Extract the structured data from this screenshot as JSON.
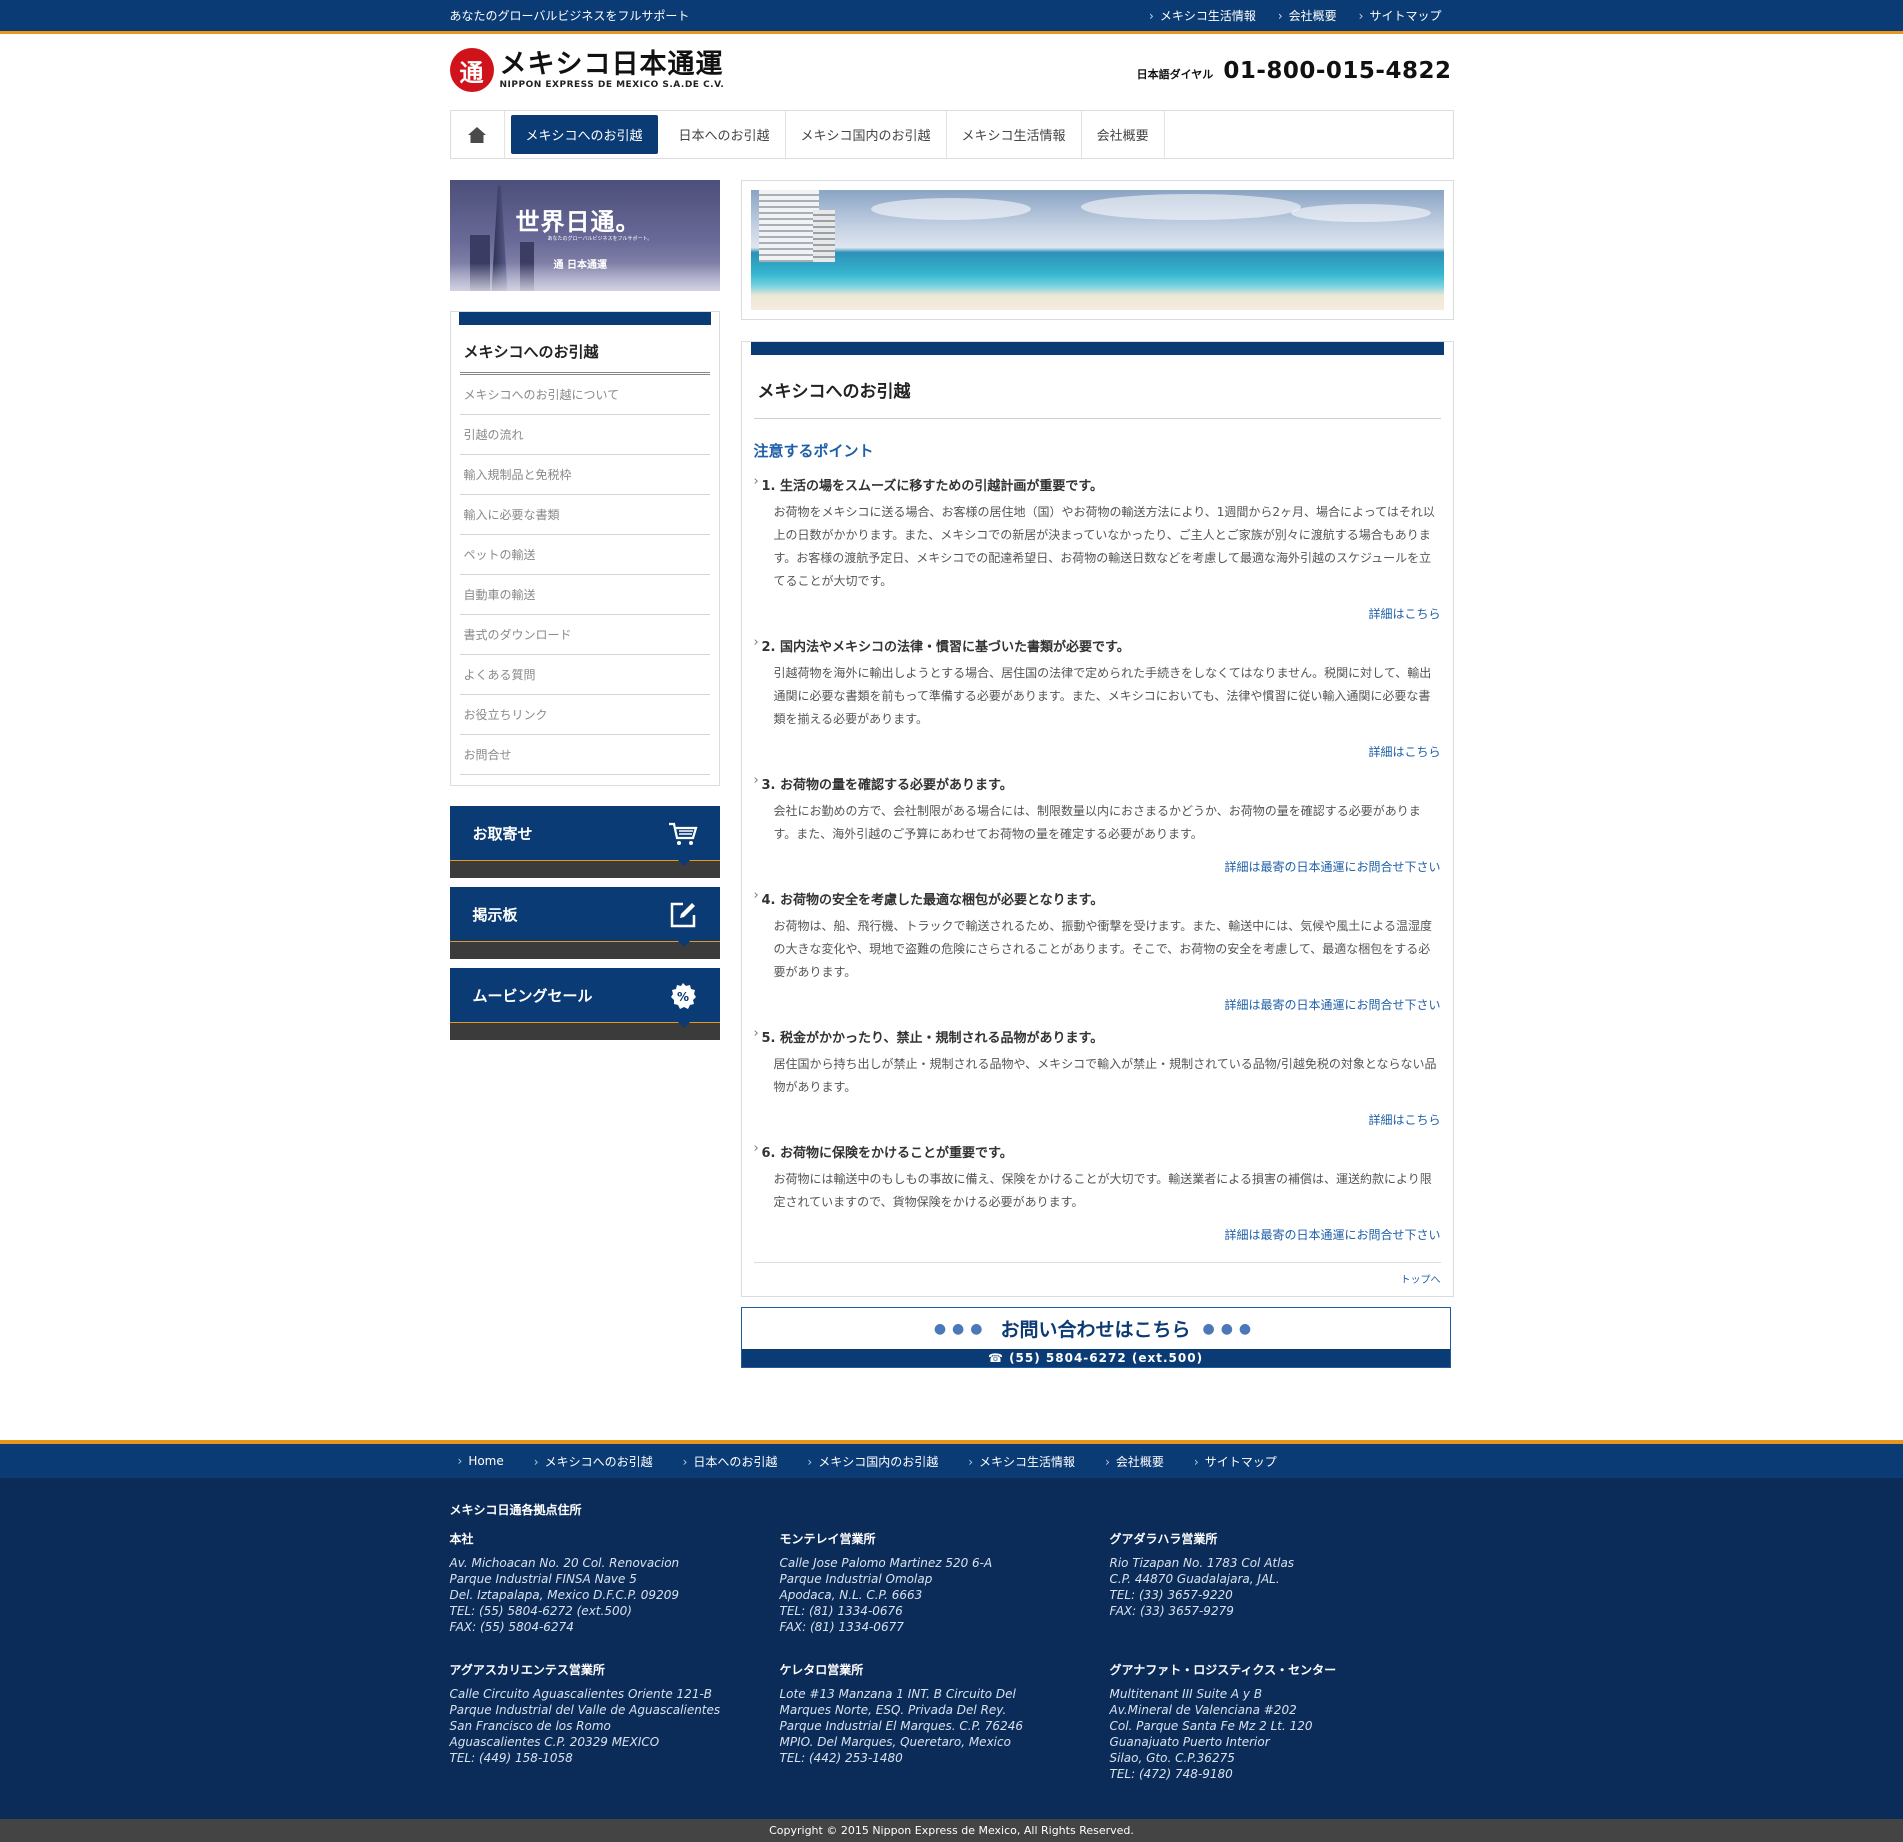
{
  "topbar": {
    "tagline": "あなたのグローバルビジネスをフルサポート",
    "links": [
      "メキシコ生活情報",
      "会社概要",
      "サイトマップ"
    ]
  },
  "header": {
    "logo_mark": "通",
    "logo_jp": "メキシコ日本通運",
    "logo_en": "NIPPON EXPRESS DE MEXICO S.A.DE C.V.",
    "dial_label": "日本語ダイヤル",
    "dial_number": "01-800-015-4822"
  },
  "gnav": {
    "items": [
      "メキシコへのお引越",
      "日本へのお引越",
      "メキシコ国内のお引越",
      "メキシコ生活情報",
      "会社概要"
    ]
  },
  "side_banner": {
    "title": "世界日通。",
    "subtitle": "あなたのグローバルビジネスをフルサポート。",
    "logo": "通 日本通運"
  },
  "submenu": {
    "title": "メキシコへのお引越",
    "items": [
      "メキシコへのお引越について",
      "引越の流れ",
      "輸入規制品と免税枠",
      "輸入に必要な書類",
      "ペットの輸送",
      "自動車の輸送",
      "書式のダウンロード",
      "よくある質問",
      "お役立ちリンク",
      "お問合せ"
    ]
  },
  "side_buttons": [
    {
      "label": "お取寄せ",
      "icon": "cart-icon"
    },
    {
      "label": "掲示板",
      "icon": "edit-icon"
    },
    {
      "label": "ムービングセール",
      "icon": "percent-icon"
    }
  ],
  "main": {
    "title": "メキシコへのお引越",
    "section_title": "注意するポイント",
    "points": [
      {
        "heading": "1. 生活の場をスムーズに移すための引越計画が重要です。",
        "body": "お荷物をメキシコに送る場合、お客様の居住地（国）やお荷物の輸送方法により、1週間から2ヶ月、場合によってはそれ以上の日数がかかります。また、メキシコでの新居が決まっていなかったり、ご主人とご家族が別々に渡航する場合もあります。お客様の渡航予定日、メキシコでの配達希望日、お荷物の輸送日数などを考慮して最適な海外引越のスケジュールを立てることが大切です。",
        "more": "詳細はこちら"
      },
      {
        "heading": "2. 国内法やメキシコの法律・慣習に基づいた書類が必要です。",
        "body": "引越荷物を海外に輸出しようとする場合、居住国の法律で定められた手続きをしなくてはなりません。税関に対して、輸出通関に必要な書類を前もって準備する必要があります。また、メキシコにおいても、法律や慣習に従い輸入通関に必要な書類を揃える必要があります。",
        "more": "詳細はこちら"
      },
      {
        "heading": "3. お荷物の量を確認する必要があります。",
        "body": "会社にお勤めの方で、会社制限がある場合には、制限数量以内におさまるかどうか、お荷物の量を確認する必要があります。また、海外引越のご予算にあわせてお荷物の量を確定する必要があります。",
        "more": "詳細は最寄の日本通運にお問合せ下さい"
      },
      {
        "heading": "4. お荷物の安全を考慮した最適な梱包が必要となります。",
        "body": "お荷物は、船、飛行機、トラックで輸送されるため、振動や衝撃を受けます。また、輸送中には、気候や風土による温湿度の大きな変化や、現地で盗難の危険にさらされることがあります。そこで、お荷物の安全を考慮して、最適な梱包をする必要があります。",
        "more": "詳細は最寄の日本通運にお問合せ下さい"
      },
      {
        "heading": "5. 税金がかかったり、禁止・規制される品物があります。",
        "body": "居住国から持ち出しが禁止・規制される品物や、メキシコで輸入が禁止・規制されている品物/引越免税の対象とならない品物があります。",
        "more": "詳細はこちら"
      },
      {
        "heading": "6. お荷物に保険をかけることが重要です。",
        "body": "お荷物には輸送中のもしもの事故に備え、保険をかけることが大切です。輸送業者による損害の補償は、運送約款により限定されていますので、貨物保険をかける必要があります。",
        "more": "詳細は最寄の日本通運にお問合せ下さい"
      }
    ],
    "totop": "トップへ"
  },
  "contact": {
    "title": "お問い合わせはこちら",
    "phone": "(55) 5804-6272 (ext.500)"
  },
  "footer": {
    "nav": [
      "Home",
      "メキシコへのお引越",
      "日本へのお引越",
      "メキシコ国内のお引越",
      "メキシコ生活情報",
      "会社概要",
      "サイトマップ"
    ],
    "heading": "メキシコ日通各拠点住所",
    "offices": [
      {
        "name": "本社",
        "lines": [
          "Av. Michoacan No. 20 Col. Renovacion",
          "Parque Industrial FINSA Nave 5",
          "Del. Iztapalapa, Mexico D.F.C.P. 09209",
          "TEL: (55) 5804-6272 (ext.500)",
          "FAX: (55) 5804-6274"
        ]
      },
      {
        "name": "モンテレイ営業所",
        "lines": [
          "Calle Jose Palomo Martinez 520 6-A",
          "Parque Industrial Omolap",
          "Apodaca, N.L. C.P. 6663",
          "TEL: (81) 1334-0676",
          "FAX: (81) 1334-0677"
        ]
      },
      {
        "name": "グアダラハラ営業所",
        "lines": [
          "Rio Tizapan No. 1783 Col Atlas",
          "C.P. 44870 Guadalajara, JAL.",
          "TEL: (33) 3657-9220",
          "FAX: (33) 3657-9279"
        ]
      },
      {
        "name": "アグアスカリエンテス営業所",
        "lines": [
          "Calle Circuito Aguascalientes Oriente 121-B",
          "Parque Industrial del Valle de Aguascalientes",
          "San Francisco de los Romo",
          "Aguascalientes C.P. 20329 MEXICO",
          "TEL: (449) 158-1058"
        ]
      },
      {
        "name": "ケレタロ営業所",
        "lines": [
          "Lote #13 Manzana 1 INT. B Circuito Del",
          "Marques Norte, ESQ. Privada Del Rey.",
          "Parque Industrial El Marques. C.P. 76246",
          "MPIO. Del Marques, Queretaro, Mexico",
          "TEL: (442) 253-1480"
        ]
      },
      {
        "name": "グアナファト・ロジスティクス・センター",
        "lines": [
          "Multitenant III Suite A y B",
          "Av.Mineral de Valenciana #202",
          "Col. Parque Santa Fe Mz 2 Lt. 120",
          "Guanajuato Puerto Interior",
          "Silao, Gto. C.P.36275",
          "TEL: (472) 748-9180"
        ]
      }
    ],
    "copyright": "Copyright © 2015 Nippon Express de Mexico, All Rights Reserved."
  }
}
